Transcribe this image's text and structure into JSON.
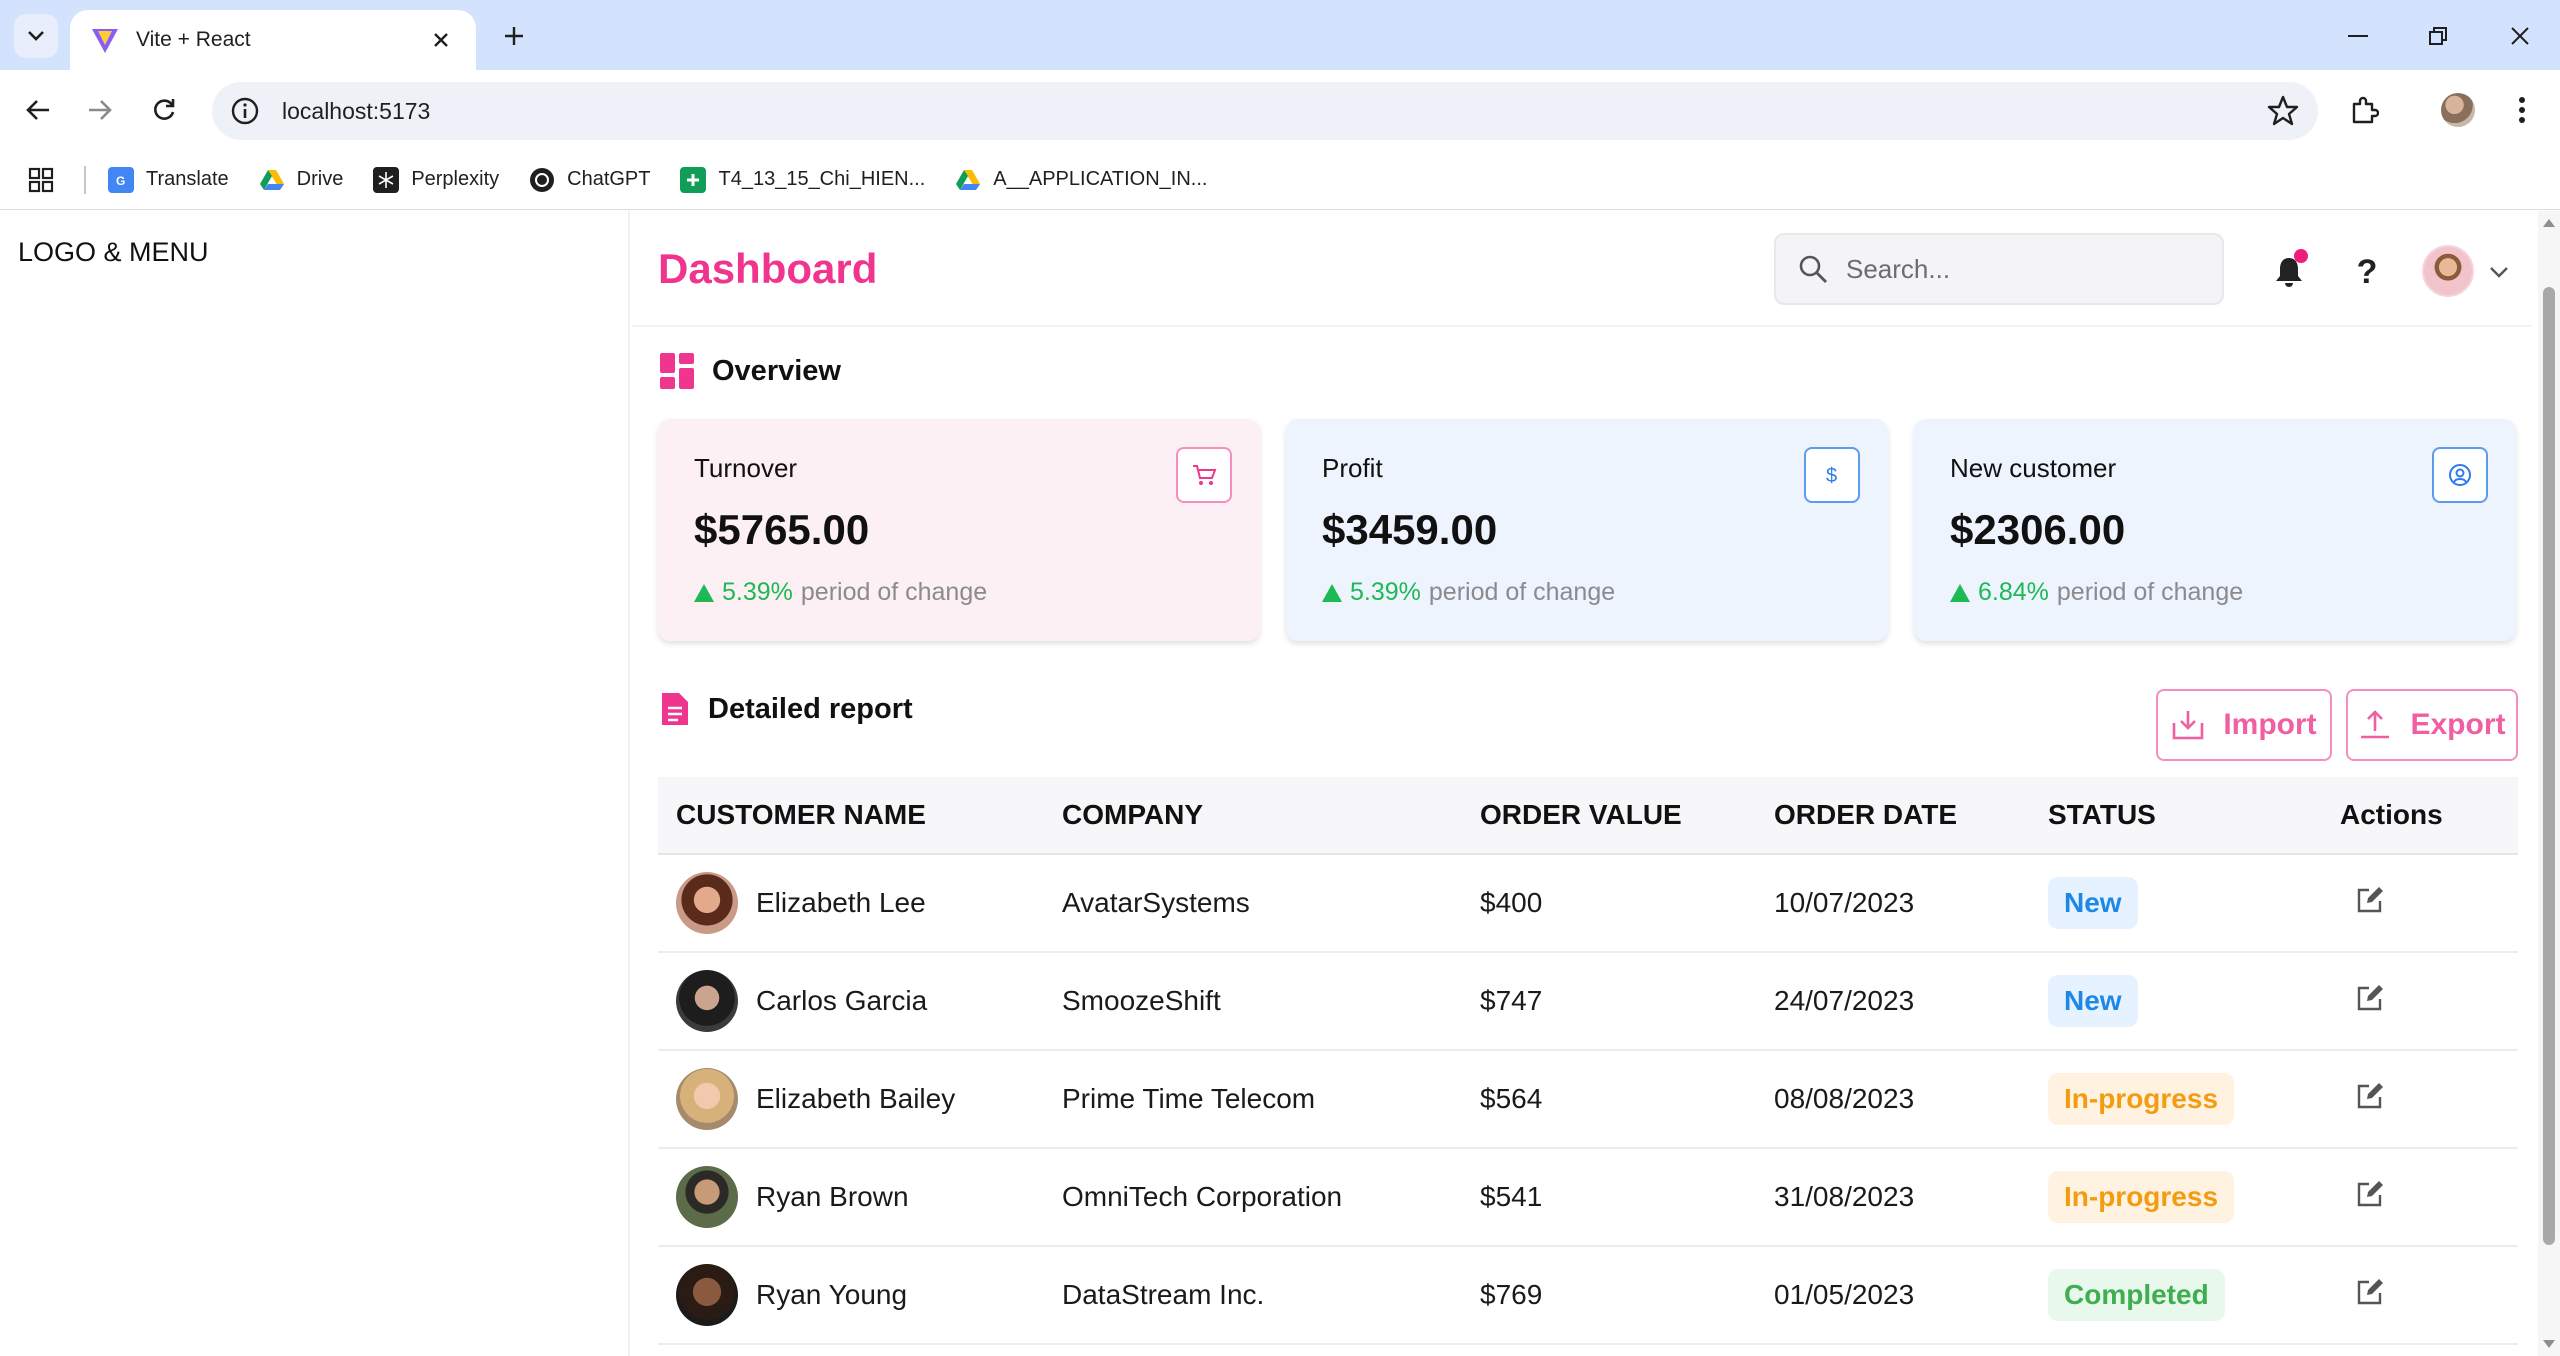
{
  "browser": {
    "tab_title": "Vite + React",
    "url": "localhost:5173",
    "bookmarks": [
      {
        "label": "Translate",
        "icon": "google-translate-icon"
      },
      {
        "label": "Drive",
        "icon": "google-drive-icon"
      },
      {
        "label": "Perplexity",
        "icon": "perplexity-icon"
      },
      {
        "label": "ChatGPT",
        "icon": "chatgpt-icon"
      },
      {
        "label": "T4_13_15_Chi_HIEN...",
        "icon": "google-sheets-icon"
      },
      {
        "label": "A__APPLICATION_IN...",
        "icon": "google-drive-icon"
      }
    ]
  },
  "sidebar": {
    "logo_text": "LOGO & MENU"
  },
  "header": {
    "title": "Dashboard",
    "search_placeholder": "Search..."
  },
  "overview": {
    "title": "Overview",
    "cards": [
      {
        "title": "Turnover",
        "value": "$5765.00",
        "delta": "5.39%",
        "delta_label": "period of change",
        "icon": "cart-icon",
        "bg": "#fdf0f5",
        "accent": "#f0358f"
      },
      {
        "title": "Profit",
        "value": "$3459.00",
        "delta": "5.39%",
        "delta_label": "period of change",
        "icon": "dollar-icon",
        "bg": "#eef4fd",
        "accent": "#2f7be8"
      },
      {
        "title": "New customer",
        "value": "$2306.00",
        "delta": "6.84%",
        "delta_label": "period of change",
        "icon": "user-circle-icon",
        "bg": "#eef4fd",
        "accent": "#2f7be8"
      }
    ]
  },
  "report": {
    "title": "Detailed report",
    "import_label": "Import",
    "export_label": "Export",
    "columns": [
      "CUSTOMER NAME",
      "COMPANY",
      "ORDER VALUE",
      "ORDER DATE",
      "STATUS",
      "Actions"
    ],
    "rows": [
      {
        "name": "Elizabeth Lee",
        "company": "AvatarSystems",
        "value": "$400",
        "date": "10/07/2023",
        "status": "New"
      },
      {
        "name": "Carlos Garcia",
        "company": "SmoozeShift",
        "value": "$747",
        "date": "24/07/2023",
        "status": "New"
      },
      {
        "name": "Elizabeth Bailey",
        "company": "Prime Time Telecom",
        "value": "$564",
        "date": "08/08/2023",
        "status": "In-progress"
      },
      {
        "name": "Ryan Brown",
        "company": "OmniTech Corporation",
        "value": "$541",
        "date": "31/08/2023",
        "status": "In-progress"
      },
      {
        "name": "Ryan Young",
        "company": "DataStream Inc.",
        "value": "$769",
        "date": "01/05/2023",
        "status": "Completed"
      }
    ]
  },
  "colors": {
    "brand": "#f0358f",
    "positive": "#1db954"
  }
}
